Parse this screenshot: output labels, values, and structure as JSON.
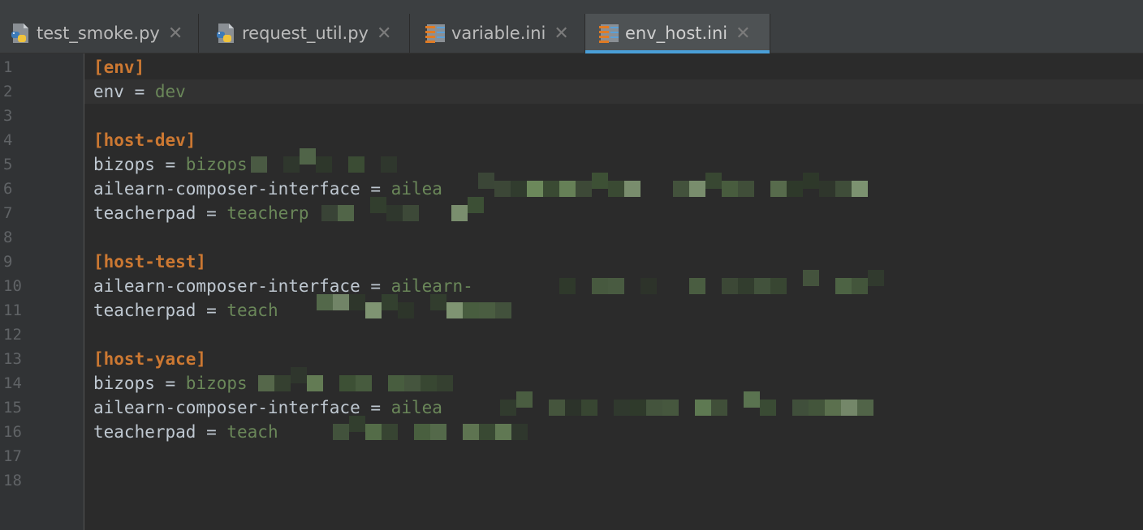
{
  "tabs": [
    {
      "label": "test_smoke.py",
      "icon": "python-file-icon",
      "active": false
    },
    {
      "label": "request_util.py",
      "icon": "python-file-icon",
      "active": false
    },
    {
      "label": "variable.ini",
      "icon": "ini-file-icon",
      "active": false
    },
    {
      "label": "env_host.ini",
      "icon": "ini-file-icon",
      "active": true
    }
  ],
  "tab_close_glyph": "✕",
  "colors": {
    "section": "#cc7832",
    "value": "#6a8759",
    "key": "#bfc8d1",
    "active_tab_underline": "#4a9fd8",
    "background": "#2b2b2b"
  },
  "editor": {
    "current_line": 2,
    "lines": [
      {
        "num": "1",
        "type": "section",
        "text": "[env]"
      },
      {
        "num": "2",
        "type": "kv",
        "key": "env",
        "op": " = ",
        "value": "dev"
      },
      {
        "num": "3",
        "type": "blank"
      },
      {
        "num": "4",
        "type": "section",
        "text": "[host-dev]"
      },
      {
        "num": "5",
        "type": "kv",
        "key": "bizops",
        "op": " = ",
        "value": "bizops"
      },
      {
        "num": "6",
        "type": "kv",
        "key": "ailearn-composer-interface",
        "op": " = ",
        "value": "ailea"
      },
      {
        "num": "7",
        "type": "kv",
        "key": "teacherpad",
        "op": " = ",
        "value": "teacherp"
      },
      {
        "num": "8",
        "type": "blank"
      },
      {
        "num": "9",
        "type": "section",
        "text": "[host-test]"
      },
      {
        "num": "10",
        "type": "kv",
        "key": "ailearn-composer-interface",
        "op": " = ",
        "value": "ailearn-"
      },
      {
        "num": "11",
        "type": "kv",
        "key": "teacherpad",
        "op": " = ",
        "value": "teach"
      },
      {
        "num": "12",
        "type": "blank"
      },
      {
        "num": "13",
        "type": "section",
        "text": "[host-yace]"
      },
      {
        "num": "14",
        "type": "kv",
        "key": "bizops",
        "op": " = ",
        "value": "bizops"
      },
      {
        "num": "15",
        "type": "kv",
        "key": "ailearn-composer-interface",
        "op": " = ",
        "value": "ailea"
      },
      {
        "num": "16",
        "type": "kv",
        "key": "teacherpad",
        "op": " = ",
        "value": "teach"
      },
      {
        "num": "17",
        "type": "blank"
      },
      {
        "num": "18",
        "type": "blank"
      }
    ]
  }
}
